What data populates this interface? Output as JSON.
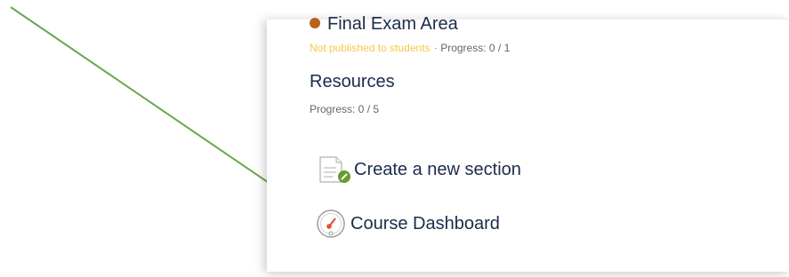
{
  "sections": [
    {
      "title": "Final Exam Area",
      "status_color": "#b5651d",
      "publish_status": "Not published to students",
      "progress": "Progress: 0 / 1"
    },
    {
      "title": "Resources",
      "progress": "Progress: 0 / 5"
    }
  ],
  "actions": {
    "create_section": "Create a new section",
    "course_dashboard": "Course Dashboard"
  },
  "colors": {
    "arrow": "#6aa84f",
    "status_warning": "#f3c84a",
    "text_primary": "#1b2b4b"
  },
  "icons": {
    "create_section": "document-plus-icon",
    "course_dashboard": "gauge-icon"
  }
}
